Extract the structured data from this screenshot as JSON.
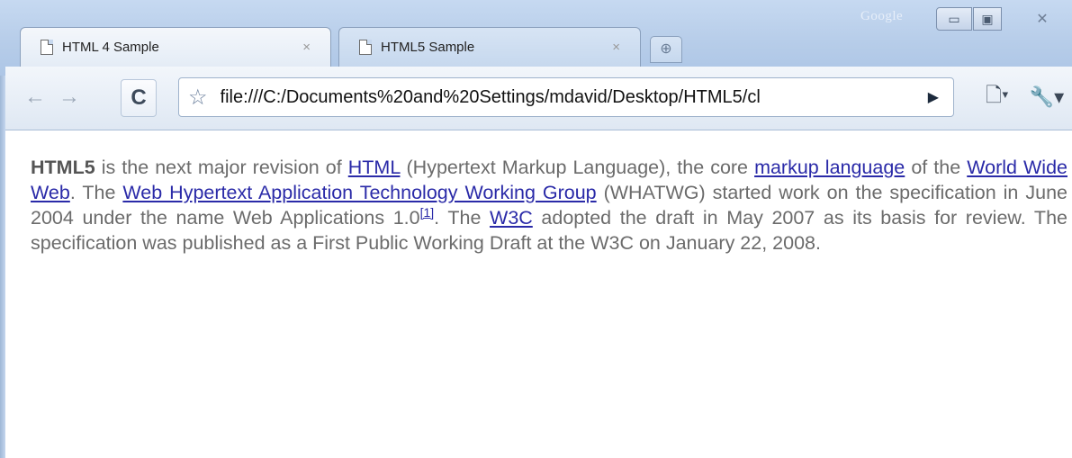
{
  "window": {
    "brand_text": "Google",
    "minimize_glyph": "▭",
    "maximize_glyph": "▣",
    "close_glyph": "✕"
  },
  "tabs": [
    {
      "label": "HTML 4 Sample",
      "active": true,
      "close_glyph": "×"
    },
    {
      "label": "HTML5 Sample",
      "active": false,
      "close_glyph": "×"
    }
  ],
  "new_tab_glyph": "⊕",
  "toolbar": {
    "back_glyph": "←",
    "forward_glyph": "→",
    "reload_glyph": "C",
    "star_glyph": "☆",
    "url": "file:///C:/Documents%20and%20Settings/mdavid/Desktop/HTML5/cl",
    "go_glyph": "▶",
    "page_menu_glyph": "🗋▾",
    "wrench_menu_glyph": "🔧▾"
  },
  "content": {
    "term": "HTML5",
    "t1": " is the next major revision of ",
    "link_html": "HTML",
    "t2": " (Hypertext Markup Language), the core ",
    "link_markup": "markup language",
    "t3": " of the ",
    "link_www": "World Wide Web",
    "t4": ". The ",
    "link_whatwg": "Web Hypertext Application Technology Working Group",
    "t5": " (WHATWG) started work on the specification in June 2004 under the name Web Applications 1.0",
    "ref": "[1]",
    "t6": ". The ",
    "link_w3c": "W3C",
    "t7": " adopted the draft in May 2007 as its basis for review. The specification was published as a First Public Working Draft at the W3C on January 22, 2008."
  },
  "colors": {
    "link": "#2a2aa8",
    "text": "#6b6b6b",
    "frame": "#b7cde9"
  }
}
